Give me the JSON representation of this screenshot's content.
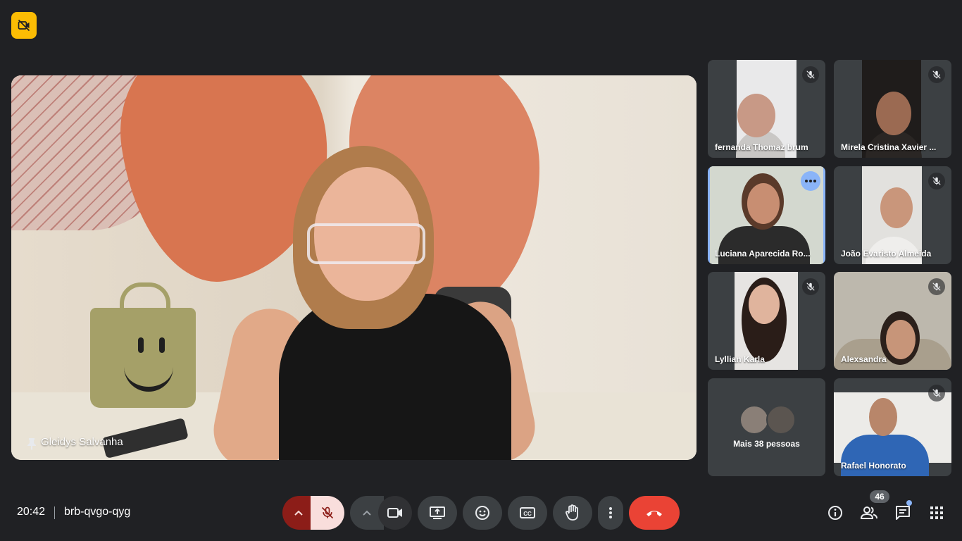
{
  "meeting": {
    "time": "20:42",
    "code": "brb-qvgo-qyg",
    "people_count": "46"
  },
  "main_speaker": {
    "name": "Gleidys Salvanha",
    "pinned": true
  },
  "participants": [
    {
      "name": "fernanda Thomaz brum",
      "muted": true
    },
    {
      "name": "Mirela Cristina Xavier ...",
      "muted": true
    },
    {
      "name": "Luciana Aparecida Ro...",
      "muted": false,
      "speaking": true
    },
    {
      "name": "João Evaristo Almeida",
      "muted": true
    },
    {
      "name": "Lyllian Karla",
      "muted": true
    },
    {
      "name": "Alexsandra",
      "muted": true
    },
    {
      "name": "Rafael Honorato",
      "muted": true
    }
  ],
  "others": {
    "label": "Mais 38 pessoas"
  },
  "icons": {
    "badge": "camera-off-icon",
    "mic": "mic-off-icon",
    "camera": "videocam-icon",
    "present": "present-screen-icon",
    "emoji": "emoji-icon",
    "captions": "closed-captions-icon",
    "hand": "raise-hand-icon",
    "more": "more-vert-icon",
    "leave": "call-end-icon",
    "info": "info-icon",
    "people": "people-icon",
    "chat": "chat-icon",
    "activities": "apps-grid-icon"
  },
  "colors": {
    "background": "#202124",
    "leave_button": "#ea4335",
    "mic_off_button": "#f9dedc",
    "mic_arrow_button": "#8c1d18",
    "badge": "#fbbc04",
    "active_border": "#8ab4f8"
  }
}
